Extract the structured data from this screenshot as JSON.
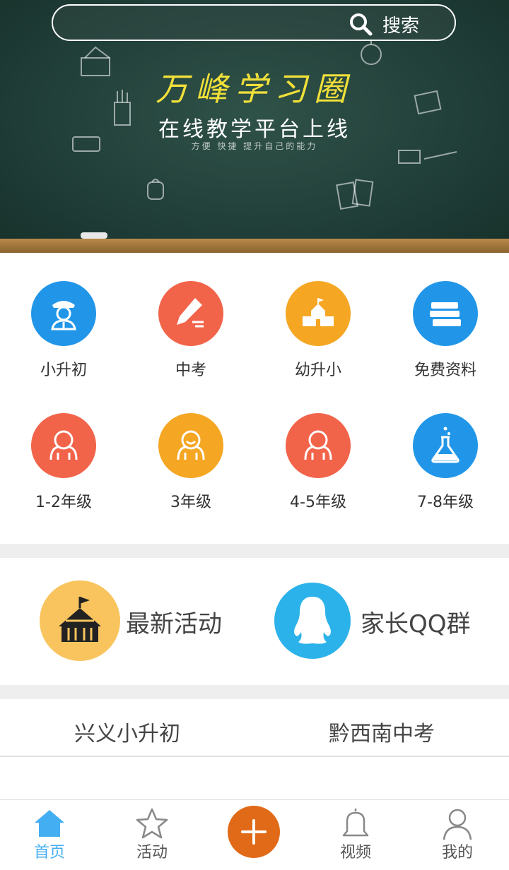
{
  "search": {
    "label": "搜索"
  },
  "banner": {
    "title": "万峰学习圈",
    "subtitle": "在线教学平台上线",
    "tagline": "方便  快捷  提升自己的能力"
  },
  "grid": [
    {
      "label": "小升初",
      "color": "#2196e8",
      "icon": "student-icon"
    },
    {
      "label": "中考",
      "color": "#f2644a",
      "icon": "pencil-icon"
    },
    {
      "label": "幼升小",
      "color": "#f5a623",
      "icon": "school-icon"
    },
    {
      "label": "免费资料",
      "color": "#2196e8",
      "icon": "books-icon"
    },
    {
      "label": "1-2年级",
      "color": "#f2644a",
      "icon": "child-icon"
    },
    {
      "label": "3年级",
      "color": "#f5a623",
      "icon": "child-icon"
    },
    {
      "label": "4-5年级",
      "color": "#f2644a",
      "icon": "child-icon"
    },
    {
      "label": "7-8年级",
      "color": "#2196e8",
      "icon": "flask-icon"
    }
  ],
  "features": [
    {
      "label": "最新活动",
      "color": "#f9c45e",
      "icon": "tent-icon"
    },
    {
      "label": "家长QQ群",
      "color": "#2cb2ea",
      "icon": "qq-icon"
    }
  ],
  "tabs": [
    {
      "label": "兴义小升初"
    },
    {
      "label": "黔西南中考"
    }
  ],
  "nav": [
    {
      "label": "首页",
      "icon": "home-icon",
      "active": true
    },
    {
      "label": "活动",
      "icon": "star-icon"
    },
    {
      "label": "",
      "icon": "plus-icon"
    },
    {
      "label": "视频",
      "icon": "bell-icon"
    },
    {
      "label": "我的",
      "icon": "person-icon"
    }
  ]
}
